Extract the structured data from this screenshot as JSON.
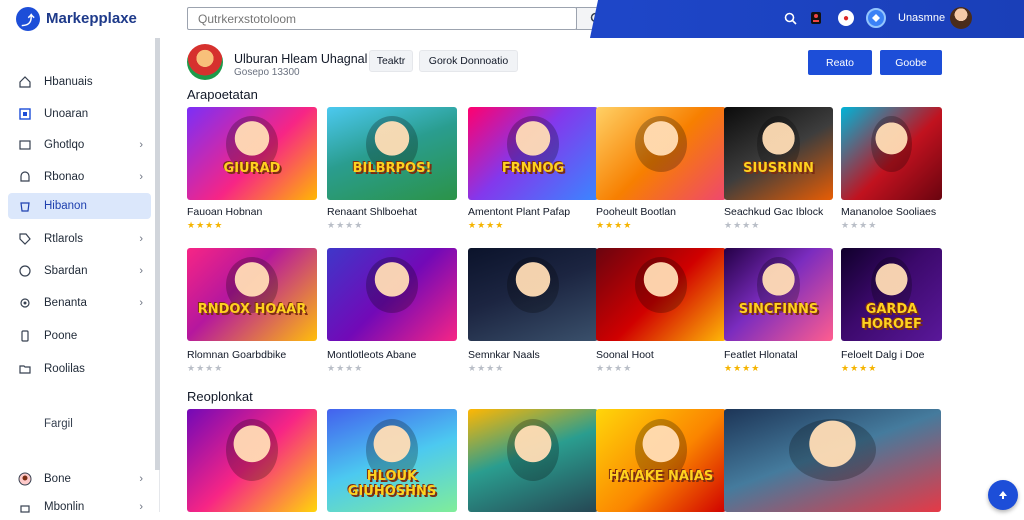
{
  "header": {
    "logo_label": "Markepplaxe",
    "search_placeholder": "Qutrkerxstotoloom",
    "user_name": "Unasmne"
  },
  "sidebar": {
    "items": [
      {
        "label": "Hbanuais",
        "icon": "home-icon",
        "chevron": false
      },
      {
        "label": "Unoaran",
        "icon": "square-icon",
        "chevron": false
      },
      {
        "label": "Ghotlqo",
        "icon": "folder-icon",
        "chevron": true
      },
      {
        "label": "Rbonao",
        "icon": "bell-icon",
        "chevron": true
      },
      {
        "label": "Hibanon",
        "icon": "bag-icon",
        "chevron": false,
        "active": true
      },
      {
        "label": "Rtlarols",
        "icon": "tag-icon",
        "chevron": true
      },
      {
        "label": "Sbardan",
        "icon": "clock-icon",
        "chevron": true
      },
      {
        "label": "Benanta",
        "icon": "gear-icon",
        "chevron": true
      },
      {
        "label": "Poone",
        "icon": "phone-icon",
        "chevron": false
      },
      {
        "label": "Roolilas",
        "icon": "folder-icon",
        "chevron": false
      }
    ],
    "footer_label": "Fargil",
    "bottom_items": [
      {
        "label": "Bone",
        "chevron": true
      },
      {
        "label": "Mbonlin",
        "chevron": true
      }
    ]
  },
  "app": {
    "title": "Ulburan Hleam Uhagnal",
    "subtitle": "Gosepo 13300",
    "chip1": "Teaktr",
    "chip2": "Gorok   Donnoatio",
    "button1": "Reato",
    "button2": "Goobe"
  },
  "sections": [
    {
      "title": "Arapoetatan"
    },
    {
      "title": "Reoplonkat"
    }
  ],
  "row1": [
    {
      "title": "Fauoan Hobnan",
      "rating": 4,
      "art": "GIURAD",
      "bg": "linear-gradient(135deg,#7b2ff7 0%,#f72585 55%,#ffb703 100%)"
    },
    {
      "title": "Renaant Shlboehat",
      "rating": 0,
      "art": "BILBRPOS!",
      "bg": "linear-gradient(160deg,#4cc9f0 0%,#2a9d8f 45%,#2b9348 100%)"
    },
    {
      "title": "Amentont Plant Pafap",
      "rating": 4,
      "art": "FRNNOG",
      "bg": "linear-gradient(135deg,#ff006e 0%,#8338ec 45%,#3a86ff 100%)"
    },
    {
      "title": "Pooheult Bootlan",
      "rating": 4,
      "art": "",
      "bg": "linear-gradient(135deg,#ffd166 0%,#f77f00 50%,#ef476f 100%)"
    },
    {
      "title": "Seachkud Gac Iblock",
      "rating": 0,
      "art": "SIUSRINN",
      "bg": "linear-gradient(150deg,#0b0b0b 0%,#3d3d3d 50%,#e85d04 100%)"
    },
    {
      "title": "Mananoloe Sooliaes",
      "rating": 0,
      "art": "",
      "bg": "linear-gradient(135deg,#00b4d8 0%,#c1121f 55%,#6a040f 100%)"
    }
  ],
  "row2": [
    {
      "title": "Rlomnan Goarbdbike",
      "rating": 0,
      "art": "RNDOX HOAAR",
      "bg": "linear-gradient(135deg,#f72585 0%,#b5179e 40%,#ffbe0b 100%)"
    },
    {
      "title": "Montlotleots Abane",
      "rating": 0,
      "art": "",
      "bg": "linear-gradient(135deg,#3f37c9 0%,#7209b7 50%,#f72585 100%)"
    },
    {
      "title": "Semnkar Naals",
      "rating": 0,
      "art": "",
      "bg": "linear-gradient(160deg,#0b132b 0%,#1c2541 45%,#3a506b 100%)"
    },
    {
      "title": "Soonal Hoot",
      "rating": 0,
      "art": "",
      "bg": "linear-gradient(135deg,#6a040f 0%,#d00000 50%,#ffba08 100%)"
    },
    {
      "title": "Featlet Hlonatal",
      "rating": 4,
      "art": "SINCFINNS",
      "bg": "linear-gradient(135deg,#240046 0%,#7b2cbf 45%,#ff5d8f 100%)"
    },
    {
      "title": "Feloelt Dalg i Doe",
      "rating": 4,
      "art": "GARDA HOROEF",
      "bg": "linear-gradient(135deg,#10002b 0%,#3c096c 45%,#5a189a 100%)"
    }
  ],
  "row3": [
    {
      "art": "",
      "bg": "linear-gradient(135deg,#7209b7 0%,#f72585 50%,#ffd60a 100%)"
    },
    {
      "art": "HLOUK GIUHOSHNS",
      "bg": "linear-gradient(160deg,#4361ee 0%,#4cc9f0 50%,#80ed99 100%)"
    },
    {
      "art": "",
      "bg": "linear-gradient(160deg,#ffb703 0%,#2a9d8f 45%,#264653 100%)"
    },
    {
      "art": "HAIAKE NAIAS",
      "bg": "linear-gradient(135deg,#ffd60a 0%,#fb8500 55%,#d00000 100%)"
    },
    {
      "art": "",
      "bg": "linear-gradient(160deg,#1d3557 0%,#457b9d 45%,#e63946 100%)"
    }
  ],
  "row2_extra_ratings": [
    "☆☆☆☆",
    "☆☆☆☆",
    "☆☆☆☆"
  ],
  "fab_icon": "up-arrow-icon"
}
